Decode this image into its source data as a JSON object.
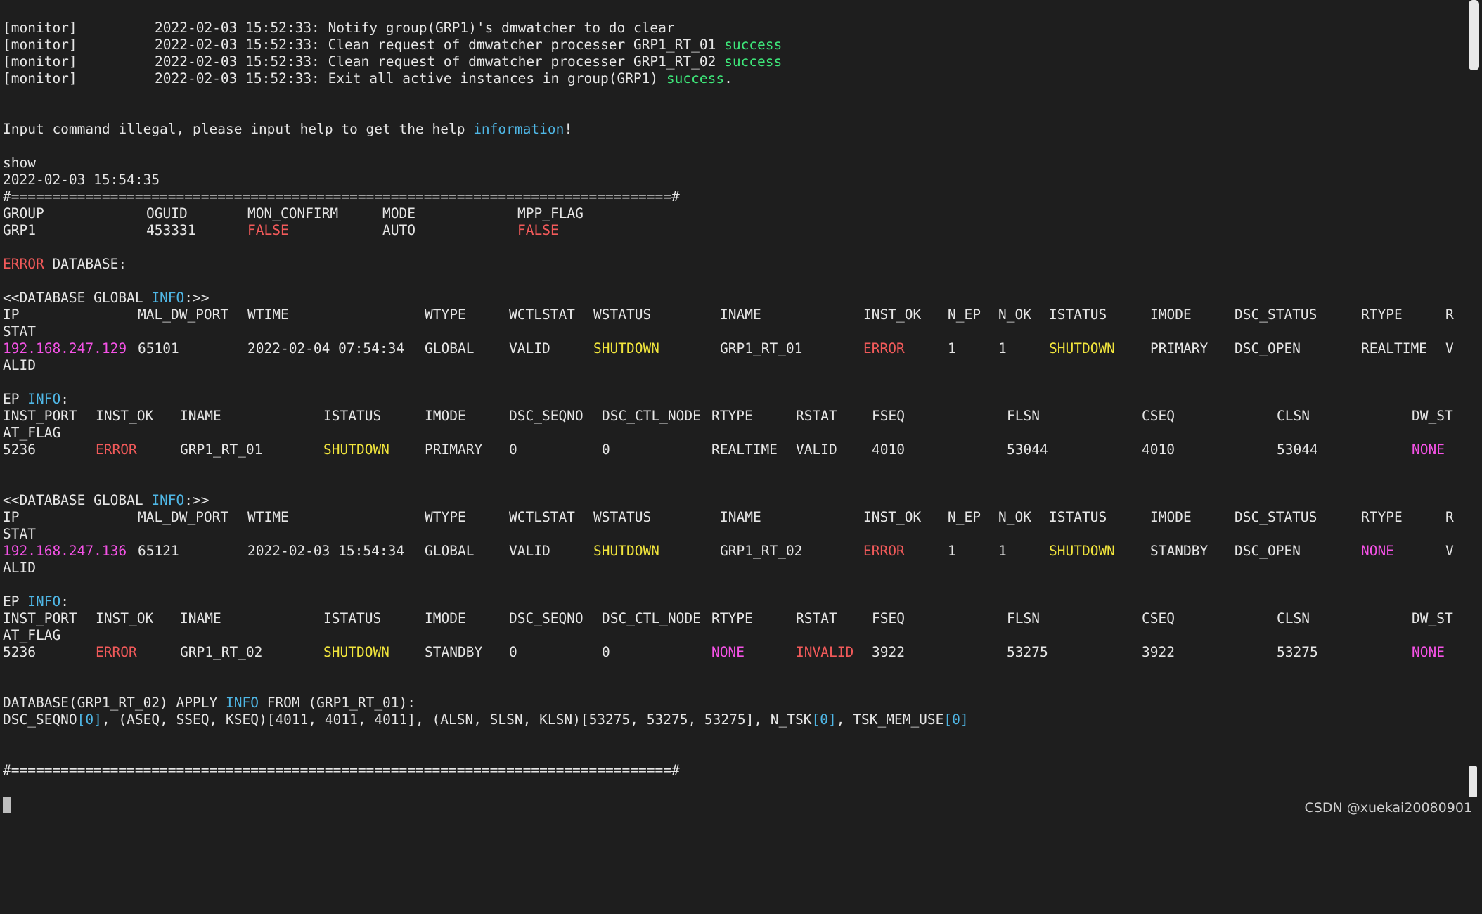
{
  "monitor": [
    {
      "tag": "[monitor]",
      "ts": "2022-02-03 15:52:33:",
      "msg": "Notify group(GRP1)'s dmwatcher to do clear",
      "ok": "",
      "tail": ""
    },
    {
      "tag": "[monitor]",
      "ts": "2022-02-03 15:52:33:",
      "msg": "Clean request of dmwatcher processer GRP1_RT_01",
      "ok": "success",
      "tail": ""
    },
    {
      "tag": "[monitor]",
      "ts": "2022-02-03 15:52:33:",
      "msg": "Clean request of dmwatcher processer GRP1_RT_02",
      "ok": "success",
      "tail": ""
    },
    {
      "tag": "[monitor]",
      "ts": "2022-02-03 15:52:33:",
      "msg": "Exit all active instances in group(GRP1)",
      "ok": "success",
      "tail": "."
    }
  ],
  "illegal": {
    "pre": "Input command illegal, please input help to get the help ",
    "word": "information",
    "post": "!"
  },
  "show": {
    "cmd": "show",
    "time": "2022-02-03 15:54:35"
  },
  "separator": "#================================================================================#",
  "group": {
    "headers": [
      "GROUP",
      "OGUID",
      "MON_CONFIRM",
      "MODE",
      "MPP_FLAG"
    ],
    "values": [
      "GRP1",
      "453331",
      "FALSE",
      "AUTO",
      "FALSE"
    ]
  },
  "error_db": {
    "error": "ERROR",
    "rest": " DATABASE:"
  },
  "db_global_label": {
    "pre": "<<DATABASE GLOBAL ",
    "info": "INFO",
    "post": ":>>"
  },
  "ep_label": {
    "pre": "EP ",
    "info": "INFO",
    "post": ":"
  },
  "db_headers": [
    "IP",
    "MAL_DW_PORT",
    "WTIME",
    "WTYPE",
    "WCTLSTAT",
    "WSTATUS",
    "INAME",
    "INST_OK",
    "N_EP",
    "N_OK",
    "ISTATUS",
    "IMODE",
    "DSC_STATUS",
    "RTYPE",
    "R"
  ],
  "db_header_wrap": "STAT",
  "ep_headers": [
    "INST_PORT",
    "INST_OK",
    "INAME",
    "ISTATUS",
    "IMODE",
    "DSC_SEQNO",
    "DSC_CTL_NODE",
    "RTYPE",
    "RSTAT",
    "FSEQ",
    "FLSN",
    "CSEQ",
    "CLSN",
    "DW_ST"
  ],
  "ep_header_wrap": "AT_FLAG",
  "databases": [
    {
      "row": [
        "192.168.247.129",
        "65101",
        "2022-02-04 07:54:34",
        "GLOBAL",
        "VALID",
        "SHUTDOWN",
        "GRP1_RT_01",
        "ERROR",
        "1",
        "1",
        "SHUTDOWN",
        "PRIMARY",
        "DSC_OPEN",
        "REALTIME",
        "V"
      ],
      "wrap": "ALID",
      "ep": [
        "5236",
        "ERROR",
        "GRP1_RT_01",
        "SHUTDOWN",
        "PRIMARY",
        "0",
        "0",
        "REALTIME",
        "VALID",
        "4010",
        "53044",
        "4010",
        "53044",
        "NONE"
      ]
    },
    {
      "row": [
        "192.168.247.136",
        "65121",
        "2022-02-03 15:54:34",
        "GLOBAL",
        "VALID",
        "SHUTDOWN",
        "GRP1_RT_02",
        "ERROR",
        "1",
        "1",
        "SHUTDOWN",
        "STANDBY",
        "DSC_OPEN",
        "NONE",
        "V"
      ],
      "wrap": "ALID",
      "ep": [
        "5236",
        "ERROR",
        "GRP1_RT_02",
        "SHUTDOWN",
        "STANDBY",
        "0",
        "0",
        "NONE",
        "INVALID",
        "3922",
        "53275",
        "3922",
        "53275",
        "NONE"
      ]
    }
  ],
  "apply": {
    "l1_pre": "DATABASE(GRP1_RT_02) APPLY ",
    "l1_info": "INFO",
    "l1_post": " FROM (GRP1_RT_01):",
    "a": "DSC_SEQNO",
    "b": "[0]",
    "c": ", (ASEQ, SSEQ, KSEQ)[4011, 4011, 4011], (ALSN, SLSN, KLSN)[53275, 53275, 53275], N_TSK",
    "d": "[0]",
    "e": ", TSK_MEM_USE",
    "f": "[0]"
  },
  "watermark": "CSDN @xuekai20080901",
  "colors": {
    "background": "#1e1e1e",
    "text": "#e6e6e6",
    "red": "#f25a5a",
    "green": "#3ee87a",
    "blue": "#4fb7e6",
    "yellow": "#f0e43c",
    "magenta": "#f552e6"
  }
}
